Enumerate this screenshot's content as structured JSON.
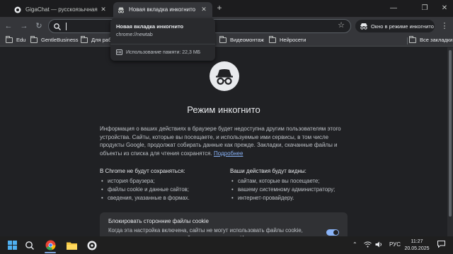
{
  "tabs": [
    {
      "title": "GigaChat — русскоязычная нейро",
      "active": false
    },
    {
      "title": "Новая вкладка инкогнито",
      "active": true
    }
  ],
  "hovercard": {
    "title": "Новая вкладка инкогнито",
    "url": "chrome://newtab",
    "memory": "Использование памяти: 22,3 МБ"
  },
  "toolbar": {
    "omnibox_value": "",
    "incognito_label": "Окно в режиме инкогнито"
  },
  "bookmarks": {
    "items": [
      "Edu",
      "GentleBusiness",
      "Для раб",
      "Видеомонтаж",
      "Нейросети"
    ],
    "all_label": "Все закладки"
  },
  "page": {
    "heading": "Режим инкогнито",
    "intro": "Информация о ваших действиях в браузере будет недоступна другим пользователям этого устройства. Сайты, которые вы посещаете, и используемые ими сервисы, в том числе продукты Google, продолжат собирать данные как прежде. Закладки, скачанные файлы и объекты из списка для чтения сохранятся.",
    "more_link": "Подробнее",
    "not_saved_title": "В Chrome не будут сохраняться:",
    "not_saved": [
      "история браузера;",
      "файлы cookie и данные сайтов;",
      "сведения, указанные в формах."
    ],
    "visible_title": "Ваши действия будут видны:",
    "visible": [
      "сайтам, которые вы посещаете;",
      "вашему системному администратору;",
      "интернет-провайдеру."
    ],
    "cookie_title": "Блокировать сторонние файлы cookie",
    "cookie_desc": "Когда эта настройка включена, сайты не могут использовать файлы cookie, которые отслеживают ваши действия в интернете. Из-за этого некоторые",
    "cookie_toggle_on": true
  },
  "taskbar": {
    "lang": "РУС",
    "time": "11:27",
    "date": "20.05.2025"
  },
  "colors": {
    "accent": "#8ab4f8",
    "page_bg": "#202124",
    "toolbar_bg": "#35363a"
  }
}
